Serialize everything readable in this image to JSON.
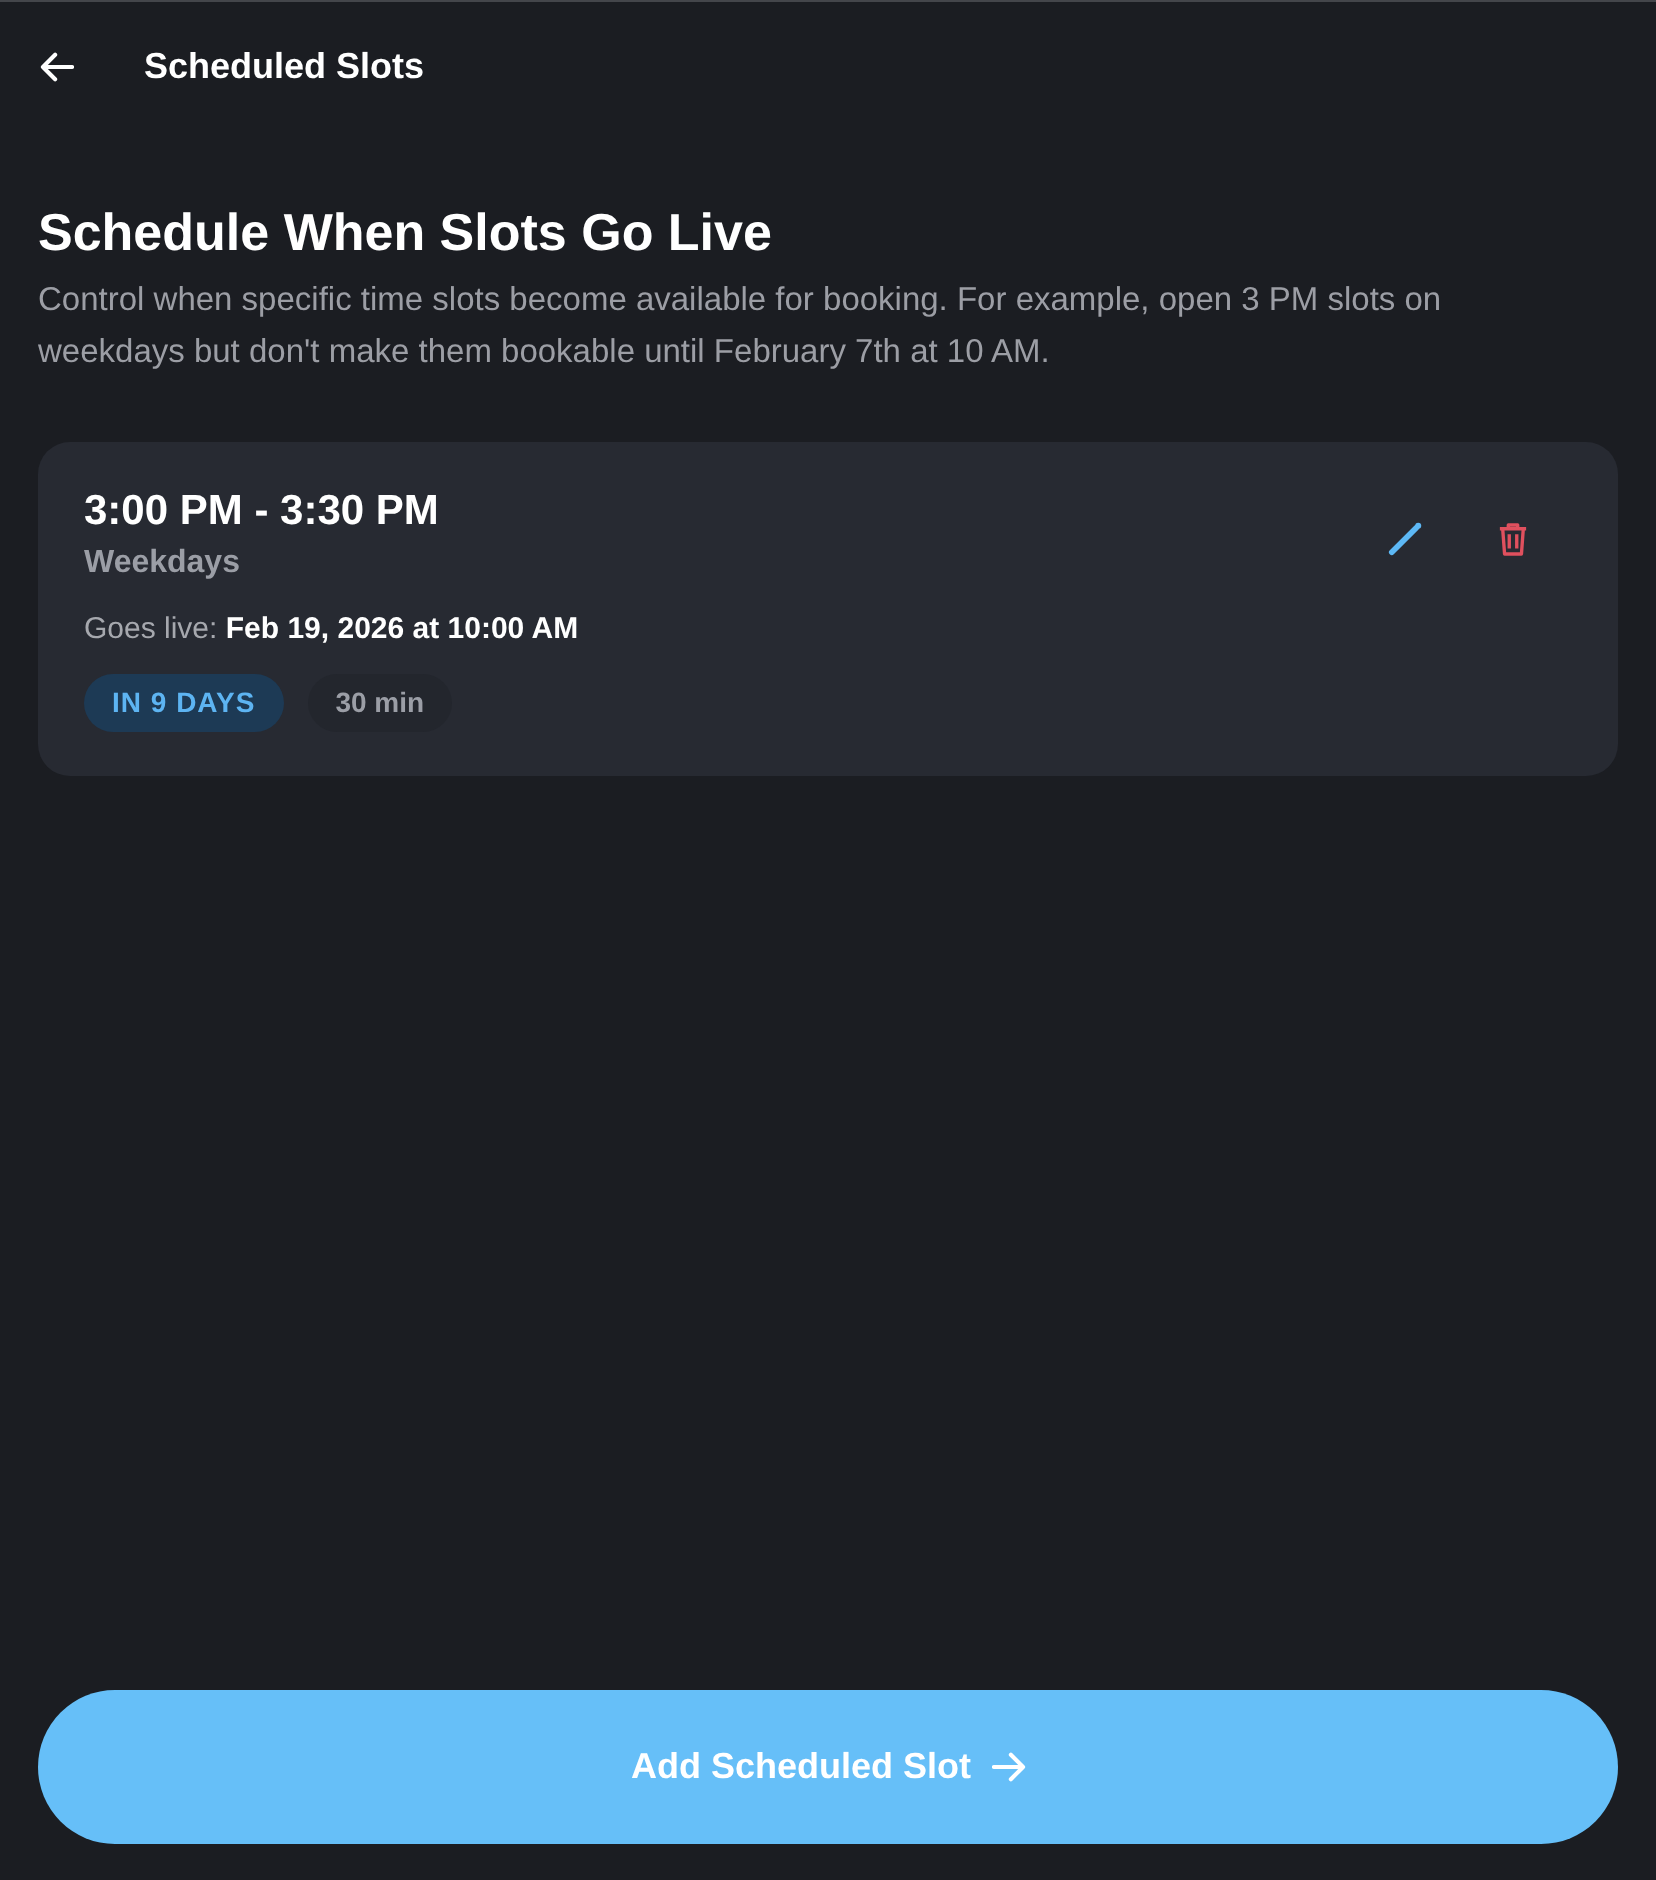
{
  "header": {
    "title": "Scheduled Slots"
  },
  "intro": {
    "heading": "Schedule When Slots Go Live",
    "description": "Control when specific time slots become available for booking. For example, open 3 PM slots on weekdays but don't make them bookable until February 7th at 10 AM."
  },
  "slots": [
    {
      "time": "3:00 PM - 3:30 PM",
      "days": "Weekdays",
      "goes_live": "Goes live: **Feb 19, 2026 at 10:00 AM**",
      "badges": [
        {
          "kind": "countdown",
          "text": "IN 9 DAYS"
        },
        {
          "kind": "duration",
          "text": "30 min"
        }
      ]
    }
  ],
  "add_button": {
    "label": "Add Scheduled Slot"
  }
}
